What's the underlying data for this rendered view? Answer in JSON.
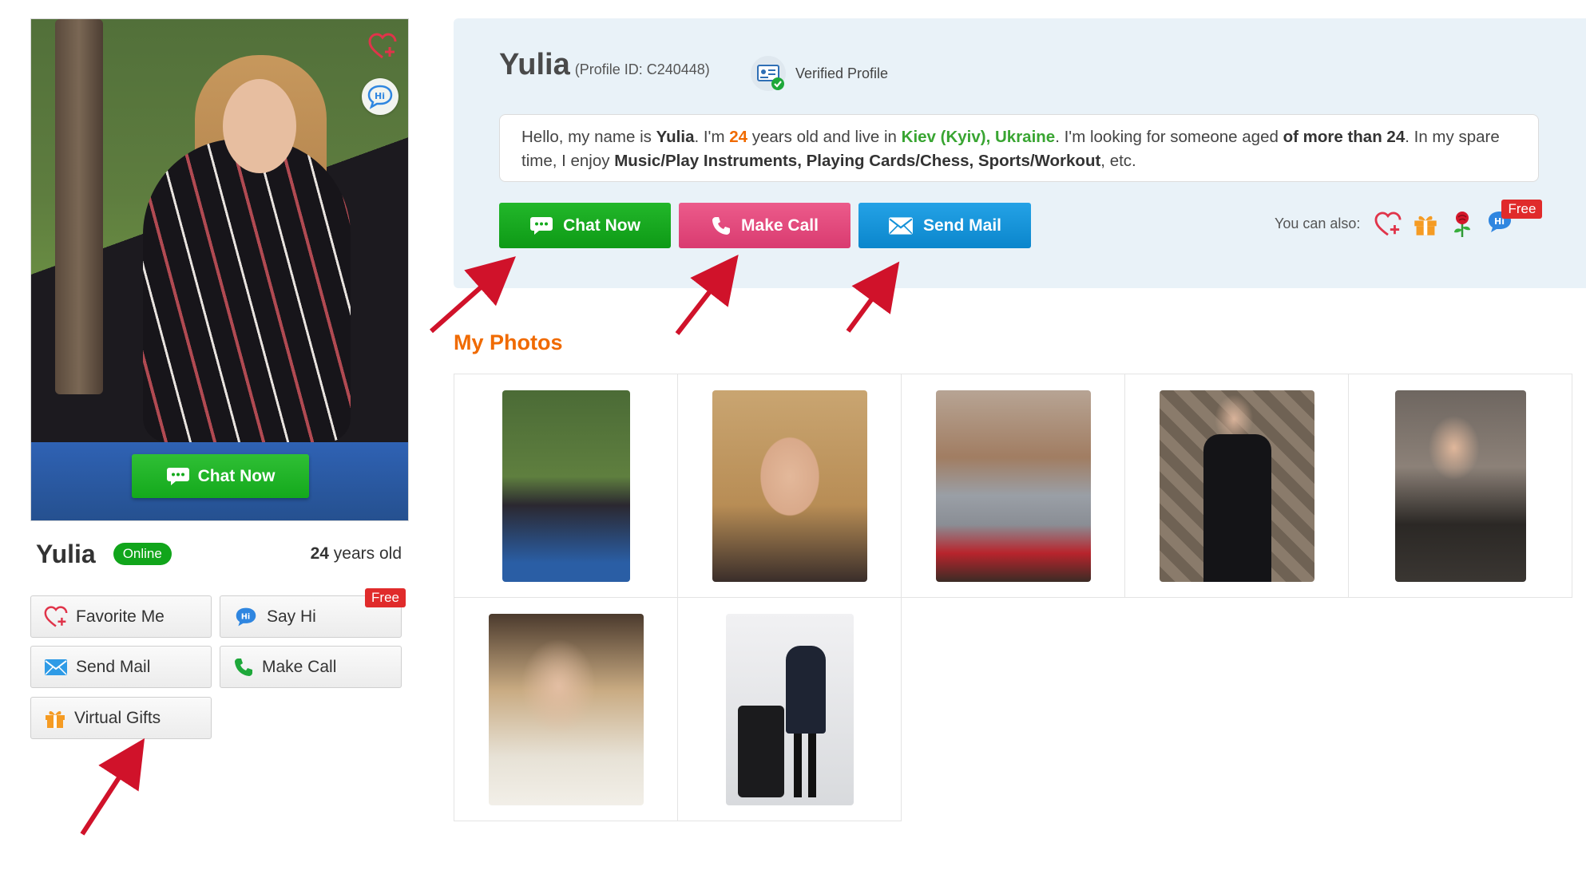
{
  "profile": {
    "name": "Yulia",
    "online_label": "Online",
    "age_num": "24",
    "age_suffix": " years old",
    "profile_id": "(Profile ID: C240448)",
    "verified_label": "Verified Profile"
  },
  "photo_overlay": {
    "chat_label": "Chat Now",
    "favorite_icon": "heart-plus-icon",
    "hi_icon": "hi-bubble-icon"
  },
  "side_actions": {
    "favorite": "Favorite Me",
    "say_hi": "Say Hi",
    "say_hi_tag": "Free",
    "send_mail": "Send Mail",
    "make_call": "Make Call",
    "virtual_gifts": "Virtual Gifts"
  },
  "bio": {
    "p1": "Hello, my name is ",
    "name": "Yulia",
    "p2": ". I'm ",
    "age": "24",
    "p3": " years old and live in ",
    "location": "Kiev (Kyiv), Ukraine",
    "p4": ". I'm looking for someone aged ",
    "aged": "of more than 24",
    "p5": ". In my spare time, I enjoy ",
    "hobbies": "Music/Play Instruments, Playing Cards/Chess, Sports/Workout",
    "p6": ", etc."
  },
  "main_actions": {
    "chat": "Chat Now",
    "call": "Make Call",
    "mail": "Send Mail",
    "also_label": "You can also:",
    "also_free_tag": "Free"
  },
  "photos": {
    "title": "My Photos"
  },
  "colors": {
    "accent_orange": "#f06a00",
    "chat_green": "#14a91c",
    "call_pink": "#e0487a",
    "mail_blue": "#1592d8",
    "panel_bg": "#e9f2f8",
    "annotation_arrow": "#d0122a"
  }
}
